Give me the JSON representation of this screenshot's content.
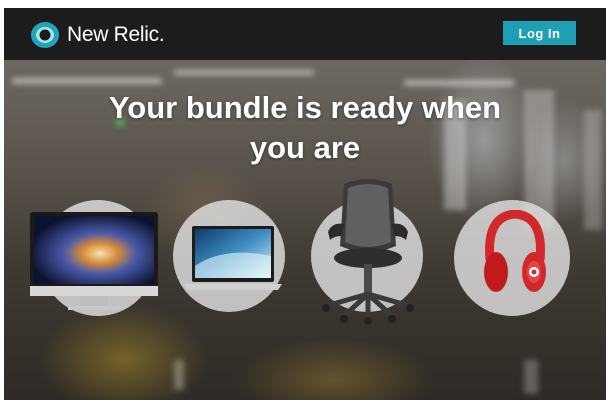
{
  "header": {
    "brand": "New Relic.",
    "login_label": "Log In"
  },
  "hero": {
    "headline": "Your bundle is ready when you are"
  },
  "bundle_items": [
    {
      "name": "iMac desktop computer"
    },
    {
      "name": "MacBook Pro laptop"
    },
    {
      "name": "Aeron office chair"
    },
    {
      "name": "Beats red headphones"
    }
  ],
  "colors": {
    "topbar": "#1c1c1c",
    "login_button": "#1e9fb3",
    "headline_text": "#ffffff",
    "headphones": "#d3282b"
  }
}
